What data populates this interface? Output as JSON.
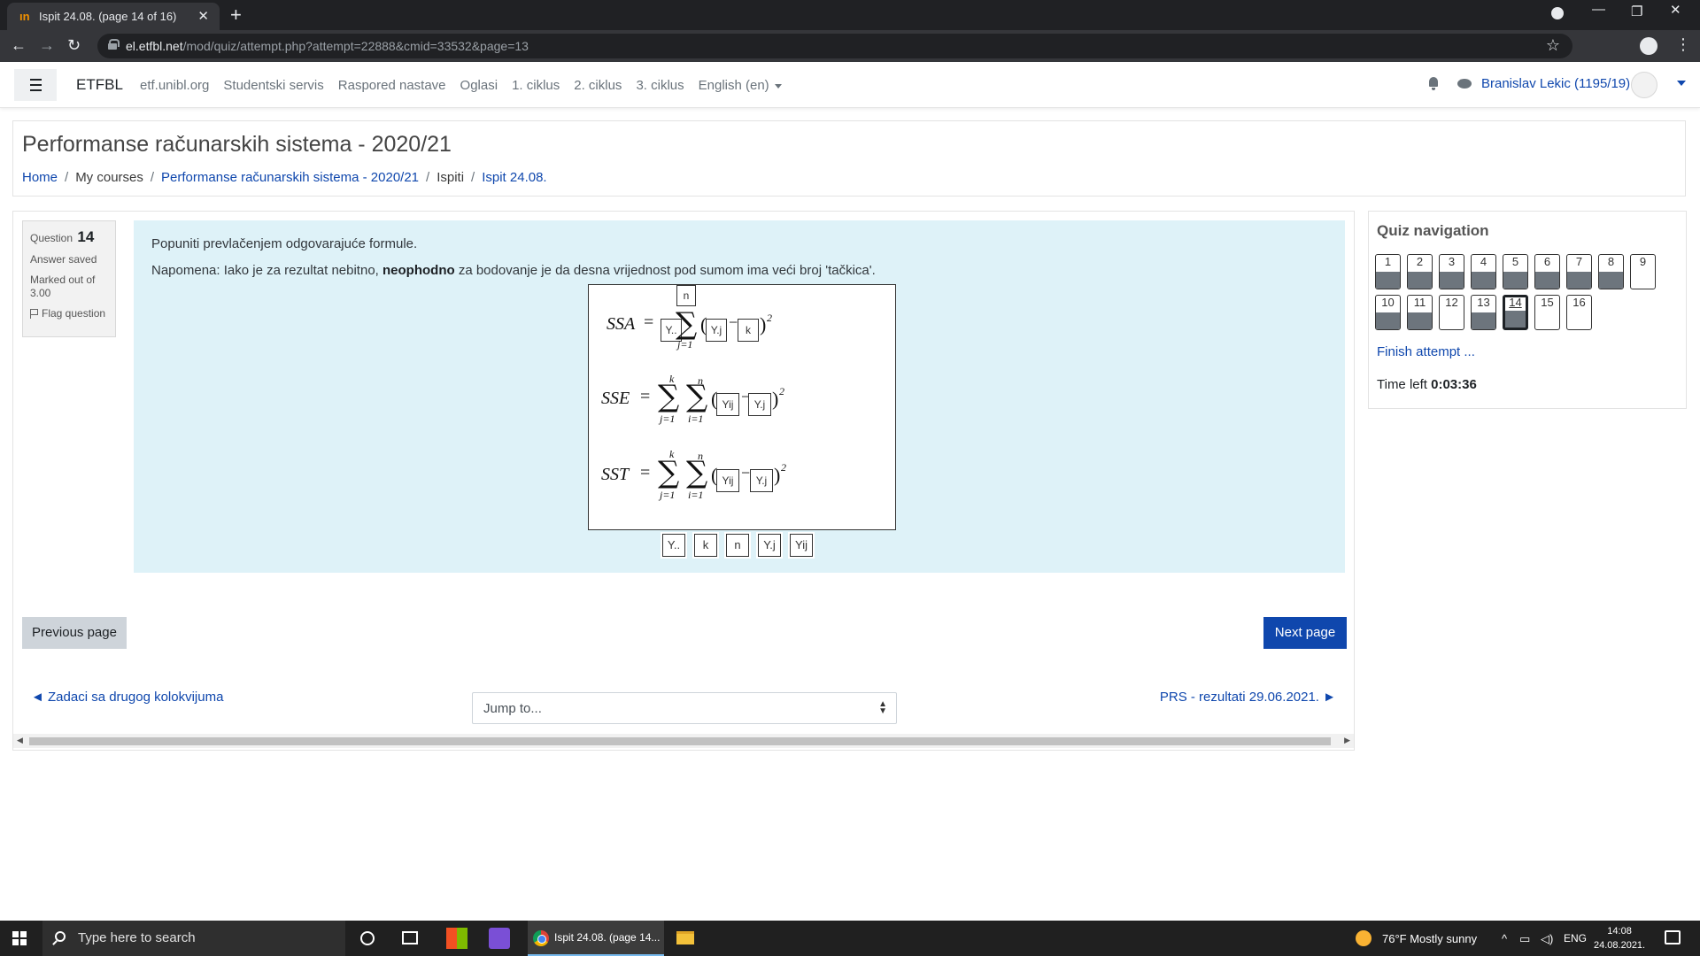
{
  "browser": {
    "tab_title": "Ispit 24.08. (page 14 of 16)",
    "url_host": "el.etfbl.net",
    "url_path": "/mod/quiz/attempt.php?attempt=22888&cmid=33532&page=13"
  },
  "navbar": {
    "brand": "ETFBL",
    "links": [
      "etf.unibl.org",
      "Studentski servis",
      "Raspored nastave",
      "Oglasi",
      "1. ciklus",
      "2. ciklus",
      "3. ciklus",
      "English (en)"
    ],
    "user": "Branislav Lekic (1195/19)"
  },
  "header": {
    "course_title": "Performanse računarskih sistema - 2020/21",
    "breadcrumb": [
      "Home",
      "My courses",
      "Performanse računarskih sistema - 2020/21",
      "Ispiti",
      "Ispit 24.08."
    ]
  },
  "question": {
    "label": "Question",
    "number": "14",
    "state": "Answer saved",
    "marked": "Marked out of 3.00",
    "flag": "Flag question",
    "text1": "Popuniti prevlačenjem odgovarajuće formule.",
    "text2_pre": "Napomena: Iako je za rezultat nebitno, ",
    "text2_bold": "neophodno",
    "text2_post": " za bodovanje je da desna vrijednost pod sumom ima veći broj 'tačkica'.",
    "formulas": {
      "ssa": "SSA",
      "sse": "SSE",
      "sst": "SST",
      "eq": "=",
      "sum": "∑",
      "j1": "j=1",
      "i1": "i=1",
      "k": "k",
      "n": "n",
      "sq": "2",
      "lp": "(",
      "rp": ")",
      "minus": "−"
    },
    "drops": {
      "ssa_top": "n",
      "ssa_a": "Y..",
      "ssa_b": "Y.j",
      "ssa_c": "k",
      "sse_a": "Yij",
      "sse_b": "Y.j",
      "sst_a": "Yij",
      "sst_b": "Y.j"
    },
    "drag_items": [
      "Y..",
      "k",
      "n",
      "Y.j",
      "Yij"
    ]
  },
  "buttons": {
    "previous": "Previous page",
    "next": "Next page"
  },
  "activity": {
    "prev_link": "◄ Zadaci sa drugog kolokvijuma",
    "jump": "Jump to...",
    "next_link": "PRS - rezultati 29.06.2021. ►"
  },
  "quiz_nav": {
    "title": "Quiz navigation",
    "questions": [
      {
        "n": "1",
        "answered": true
      },
      {
        "n": "2",
        "answered": true
      },
      {
        "n": "3",
        "answered": true
      },
      {
        "n": "4",
        "answered": true
      },
      {
        "n": "5",
        "answered": true
      },
      {
        "n": "6",
        "answered": true
      },
      {
        "n": "7",
        "answered": true
      },
      {
        "n": "8",
        "answered": true
      },
      {
        "n": "9",
        "answered": false
      },
      {
        "n": "10",
        "answered": true
      },
      {
        "n": "11",
        "answered": true
      },
      {
        "n": "12",
        "answered": false
      },
      {
        "n": "13",
        "answered": true
      },
      {
        "n": "14",
        "answered": true,
        "current": true
      },
      {
        "n": "15",
        "answered": false
      },
      {
        "n": "16",
        "answered": false
      }
    ],
    "finish": "Finish attempt ...",
    "time_label": "Time left",
    "time_value": "0:03:36"
  },
  "taskbar": {
    "search_placeholder": "Type here to search",
    "chrome_item": "Ispit 24.08. (page 14...",
    "weather": "76°F  Mostly sunny",
    "lang": "ENG",
    "time": "14:08",
    "date": "24.08.2021."
  }
}
